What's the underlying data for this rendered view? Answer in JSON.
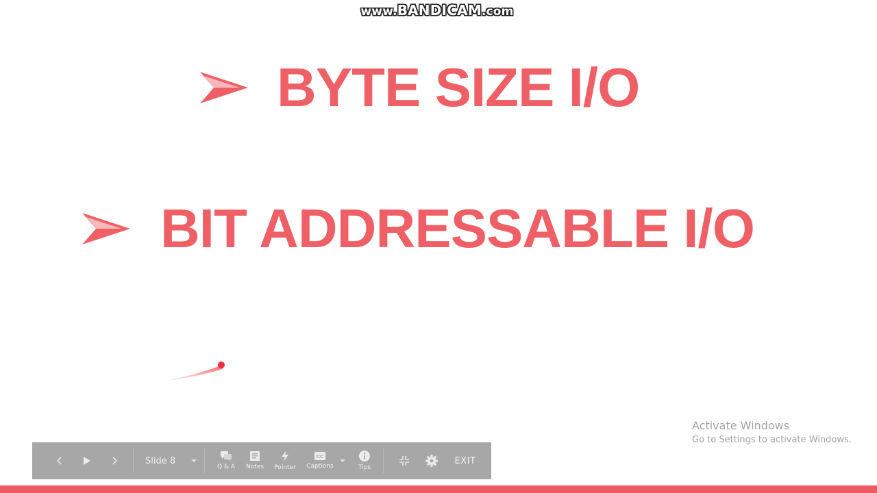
{
  "watermark": {
    "prefix": "www.",
    "brand": "BANDICAM",
    "suffix": ".com"
  },
  "slide": {
    "bullets": [
      {
        "text": "BYTE SIZE I/O",
        "icon": "arrowhead-bullet-icon"
      },
      {
        "text": "BIT ADDRESSABLE I/O",
        "icon": "arrowhead-bullet-icon"
      }
    ],
    "accent_color": "#ef5f66"
  },
  "activation_notice": {
    "title": "Activate Windows",
    "subtitle": "Go to Settings to activate Windows."
  },
  "toolbar": {
    "slide_label": "Slide 8",
    "qa_label": "Q & A",
    "notes_label": "Notes",
    "pointer_label": "Pointer",
    "captions_label": "Captions",
    "tips_label": "Tips",
    "exit_label": "EXIT",
    "background_color": "#a7a7a7"
  },
  "bottom_bar": {
    "color": "#ee5a63"
  }
}
